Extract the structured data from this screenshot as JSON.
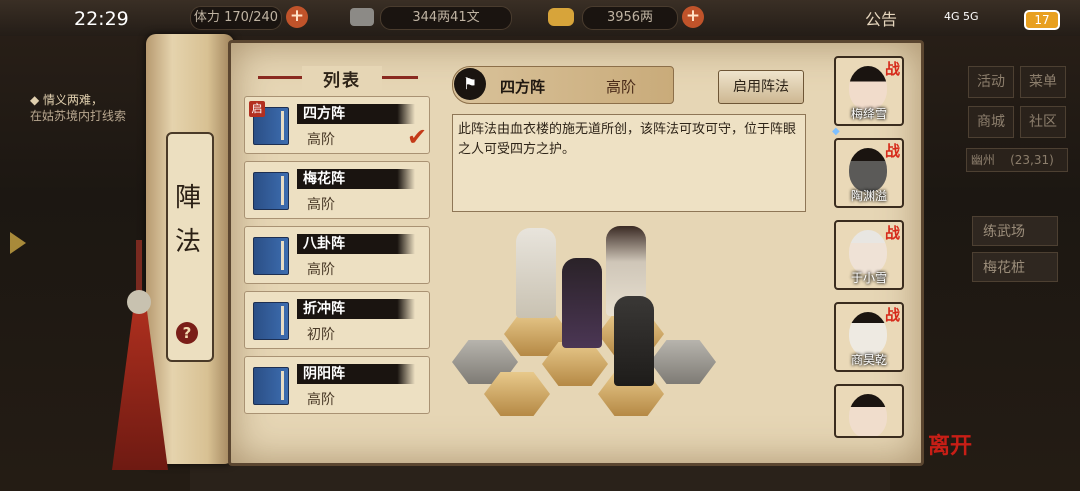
{
  "status": {
    "time": "22:29",
    "signal": "4G 5G",
    "battery": "17"
  },
  "topbar": {
    "stamina_label": "体力",
    "stamina_value": "170/240",
    "copper_value": "344两41文",
    "silver_value": "3956两",
    "announcement": "公告"
  },
  "quest": {
    "title": "情义两难，",
    "desc": "在姑苏境内打线索"
  },
  "scroll": {
    "title": "陣法",
    "help": "?"
  },
  "list": {
    "title": "列表",
    "items": [
      {
        "name": "四方阵",
        "tier": "高阶",
        "enabled": "启",
        "selected": true
      },
      {
        "name": "梅花阵",
        "tier": "高阶"
      },
      {
        "name": "八卦阵",
        "tier": "高阶"
      },
      {
        "name": "折冲阵",
        "tier": "初阶"
      },
      {
        "name": "阴阳阵",
        "tier": "高阶"
      }
    ]
  },
  "detail": {
    "name": "四方阵",
    "tier": "高阶",
    "enable_button": "启用阵法",
    "description": "此阵法由血衣楼的施无道所创，该阵法可攻可守，位于阵眼之人可受四方之护。"
  },
  "characters": [
    {
      "name": "梅绛雪",
      "tag": "战"
    },
    {
      "name": "陶渊溢",
      "tag": "战"
    },
    {
      "name": "于小雪",
      "tag": "战"
    },
    {
      "name": "商昊乾",
      "tag": "战"
    },
    {
      "name": "",
      "tag": ""
    }
  ],
  "right_menu": {
    "buttons": [
      "活动",
      "菜单",
      "商城",
      "社区"
    ],
    "location": "幽州",
    "coords": "(23,31)",
    "places": [
      "练武场",
      "梅花桩"
    ]
  },
  "bottom": {
    "leave": "离开"
  }
}
